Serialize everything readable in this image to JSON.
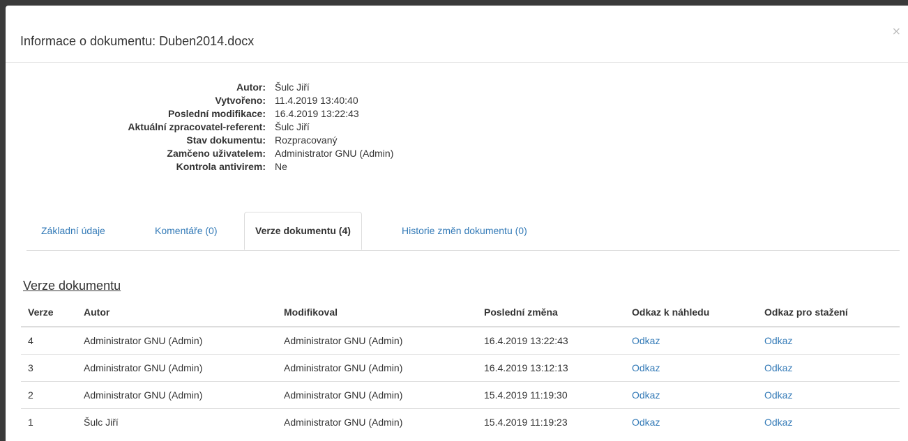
{
  "dialog": {
    "title": "Informace o dokumentu: Duben2014.docx",
    "close_label": "×"
  },
  "info": [
    {
      "label": "Autor:",
      "value": "Šulc Jiří"
    },
    {
      "label": "Vytvořeno:",
      "value": "11.4.2019 13:40:40"
    },
    {
      "label": "Poslední modifikace:",
      "value": "16.4.2019 13:22:43"
    },
    {
      "label": "Aktuální zpracovatel-referent:",
      "value": "Šulc Jiří"
    },
    {
      "label": "Stav dokumentu:",
      "value": "Rozpracovaný"
    },
    {
      "label": "Zamčeno uživatelem:",
      "value": "Administrator GNU (Admin)"
    },
    {
      "label": "Kontrola antivirem:",
      "value": "Ne"
    }
  ],
  "tabs": [
    {
      "label": "Základní údaje"
    },
    {
      "label": "Komentáře (0)"
    },
    {
      "label": "Verze dokumentu (4)"
    },
    {
      "label": "Historie změn dokumentu (0)"
    }
  ],
  "section_title": "Verze dokumentu",
  "table": {
    "headers": [
      "Verze",
      "Autor",
      "Modifikoval",
      "Poslední změna",
      "Odkaz k náhledu",
      "Odkaz pro stažení"
    ],
    "rows": [
      [
        "4",
        "Administrator GNU (Admin)",
        "Administrator GNU (Admin)",
        "16.4.2019 13:22:43",
        "Odkaz",
        "Odkaz"
      ],
      [
        "3",
        "Administrator GNU (Admin)",
        "Administrator GNU (Admin)",
        "16.4.2019 13:12:13",
        "Odkaz",
        "Odkaz"
      ],
      [
        "2",
        "Administrator GNU (Admin)",
        "Administrator GNU (Admin)",
        "15.4.2019 11:19:30",
        "Odkaz",
        "Odkaz"
      ],
      [
        "1",
        "Šulc Jiří",
        "Administrator GNU (Admin)",
        "15.4.2019 11:19:23",
        "Odkaz",
        "Odkaz"
      ]
    ]
  },
  "colors": {
    "link": "#337ab7",
    "backdrop": "#3a3a3a"
  }
}
